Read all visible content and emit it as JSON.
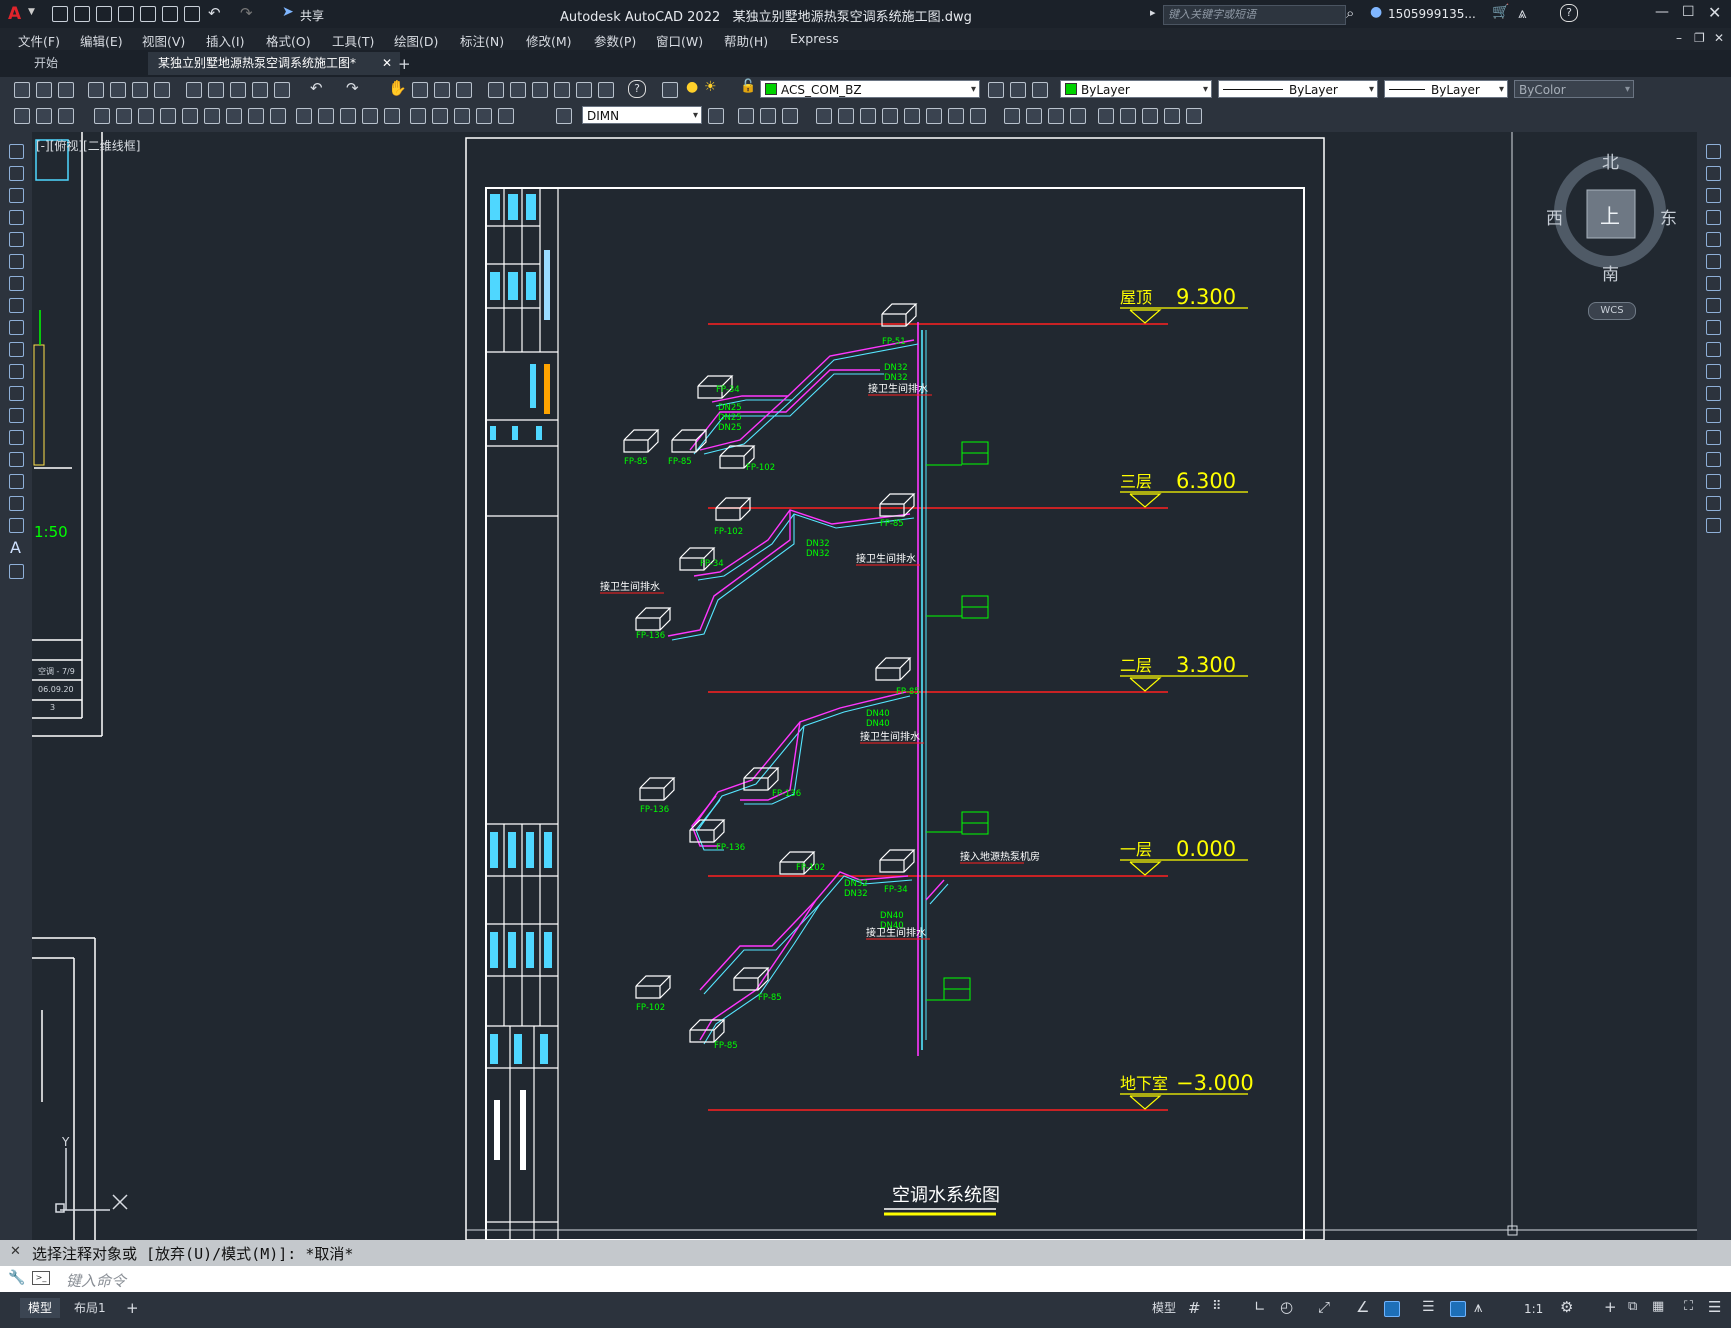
{
  "titlebar": {
    "app_title": "Autodesk AutoCAD 2022",
    "file_name": "某独立别墅地源热泵空调系统施工图.dwg",
    "share_label": "共享",
    "search_placeholder": "键入关键字或短语",
    "user_name": "1505999135..."
  },
  "menu": [
    "文件(F)",
    "编辑(E)",
    "视图(V)",
    "插入(I)",
    "格式(O)",
    "工具(T)",
    "绘图(D)",
    "标注(N)",
    "修改(M)",
    "参数(P)",
    "窗口(W)",
    "帮助(H)",
    "Express"
  ],
  "tabs": {
    "start": "开始",
    "active": "某独立别墅地源热泵空调系统施工图*"
  },
  "ribbon": {
    "layer_name": "ACS_COM_BZ",
    "color": "ByLayer",
    "linetype": "ByLayer",
    "lineweight": "ByLayer",
    "plotstyle": "ByColor",
    "dimstyle": "DIMN"
  },
  "viewport_label": "[-][俯视][二维线框]",
  "viewcube": {
    "north": "北",
    "south": "南",
    "east": "东",
    "west": "西",
    "face": "上",
    "ucs": "WCS"
  },
  "drawing": {
    "title": "空调水系统图",
    "scale_text": "1:50",
    "levels": [
      {
        "name": "屋顶",
        "elev": "9.300"
      },
      {
        "name": "三层",
        "elev": "6.300"
      },
      {
        "name": "二层",
        "elev": "3.300"
      },
      {
        "name": "一层",
        "elev": "0.000"
      },
      {
        "name": "地下室",
        "elev": "−3.000"
      }
    ],
    "unit_labels": [
      {
        "text": "FP-51"
      },
      {
        "text": "FP-34"
      },
      {
        "text": "FP-85"
      },
      {
        "text": "FP-85"
      },
      {
        "text": "FP-102"
      },
      {
        "text": "FP-102"
      },
      {
        "text": "FP-85"
      },
      {
        "text": "FP-34"
      },
      {
        "text": "FP-136"
      },
      {
        "text": "FP-85"
      },
      {
        "text": "FP-136"
      },
      {
        "text": "FP-136"
      },
      {
        "text": "FP-136"
      },
      {
        "text": "FP-102"
      },
      {
        "text": "FP-34"
      },
      {
        "text": "FP-102"
      },
      {
        "text": "FP-85"
      },
      {
        "text": "FP-85"
      }
    ],
    "pipe_labels": [
      "DN32",
      "DN32",
      "DN25",
      "DN25",
      "DN25",
      "DN32",
      "DN32",
      "DN40",
      "DN40",
      "DN32",
      "DN32",
      "DN40",
      "DN40"
    ],
    "notes": [
      {
        "text": "接卫生间排水"
      },
      {
        "text": "接卫生间排水"
      },
      {
        "text": "接卫生间排水"
      },
      {
        "text": "接卫生间排水"
      },
      {
        "text": "接卫生间排水"
      },
      {
        "text": "接入地源热泵机房"
      }
    ],
    "left_sheet": {
      "row1": "空调 - 7/9",
      "row2": "06.09.20",
      "row3": "3"
    }
  },
  "command": {
    "history": "选择注释对象或 [放弃(U)/模式(M)]: *取消*",
    "placeholder": "键入命令"
  },
  "status": {
    "model_tab": "模型",
    "layout_tab": "布局1",
    "model_btn": "模型",
    "scale": "1:1"
  }
}
